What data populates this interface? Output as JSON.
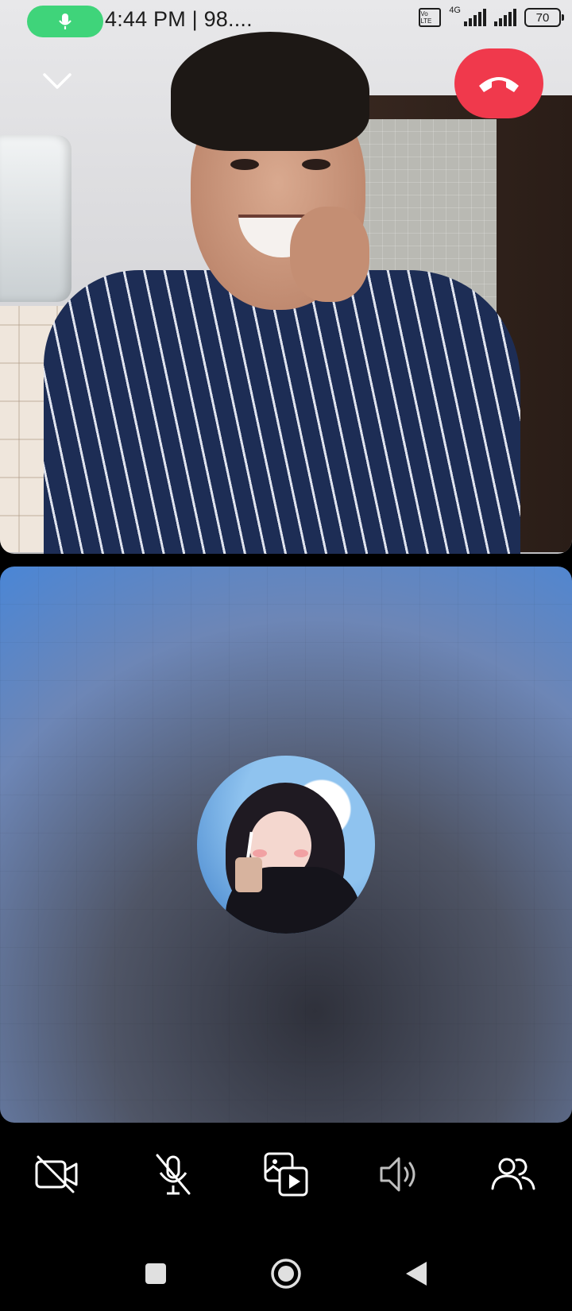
{
  "status_bar": {
    "time": "4:44 PM | 98....",
    "network_type": "4G",
    "volte_label": "Vo LTE",
    "battery": "70"
  },
  "call": {
    "remote_video": "video",
    "local_avatar": "avatar"
  },
  "icons": {
    "mic_active": "mic-icon",
    "minimize": "chevron-down-icon",
    "end_call": "phone-hangup-icon",
    "video_off": "video-off-icon",
    "mic_off": "mic-off-icon",
    "share": "media-share-icon",
    "speaker": "speaker-icon",
    "participants": "participants-icon",
    "nav_recent": "nav-square-icon",
    "nav_home": "nav-home-icon",
    "nav_back": "nav-back-icon"
  },
  "colors": {
    "end_call": "#f0394c",
    "mic_pill": "#3fd47a"
  }
}
